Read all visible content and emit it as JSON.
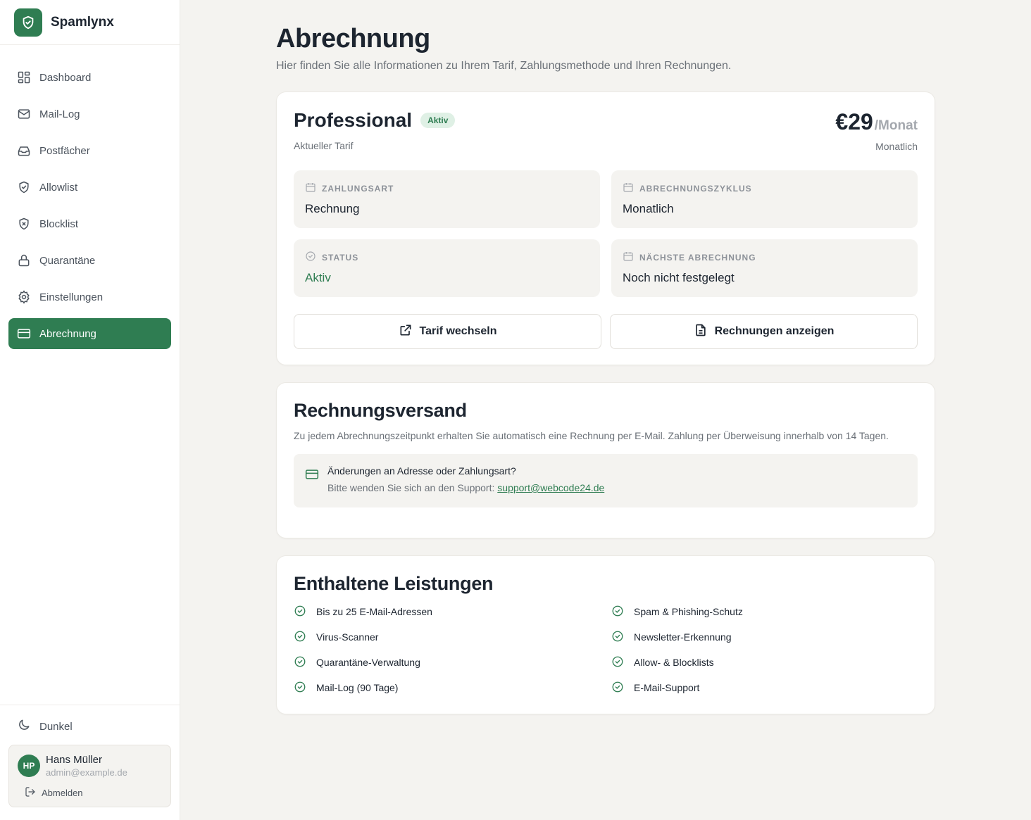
{
  "brand": {
    "name": "Spamlynx",
    "color": "#2f7d52"
  },
  "sidebar": {
    "items": [
      {
        "label": "Dashboard",
        "icon": "dashboard-icon"
      },
      {
        "label": "Mail-Log",
        "icon": "mail-icon"
      },
      {
        "label": "Postfächer",
        "icon": "inbox-icon"
      },
      {
        "label": "Allowlist",
        "icon": "shield-check-icon"
      },
      {
        "label": "Blocklist",
        "icon": "shield-x-icon"
      },
      {
        "label": "Quarantäne",
        "icon": "lock-icon"
      },
      {
        "label": "Einstellungen",
        "icon": "gear-icon"
      },
      {
        "label": "Abrechnung",
        "icon": "credit-card-icon",
        "active": true
      }
    ],
    "theme_label": "Dunkel",
    "user": {
      "initials": "HP",
      "name": "Hans Müller",
      "email": "admin@example.de"
    },
    "logout_label": "Abmelden"
  },
  "page": {
    "title": "Abrechnung",
    "subtitle": "Hier finden Sie alle Informationen zu Ihrem Tarif, Zahlungsmethode und Ihren Rechnungen."
  },
  "plan": {
    "name": "Professional",
    "badge": "Aktiv",
    "caption": "Aktueller Tarif",
    "price": "€29",
    "price_unit": "/Monat",
    "price_caption": "Monatlich",
    "tiles": {
      "payment_label": "Zahlungsart",
      "payment_value": "Rechnung",
      "cycle_label": "Abrechnungszyklus",
      "cycle_value": "Monatlich",
      "status_label": "Status",
      "status_value": "Aktiv",
      "next_label": "Nächste Abrechnung",
      "next_value": "Noch nicht festgelegt"
    },
    "change_plan_label": "Tarif wechseln",
    "show_invoices_label": "Rechnungen anzeigen"
  },
  "invoice": {
    "title": "Rechnungsversand",
    "text": "Zu jedem Abrechnungszeitpunkt erhalten Sie automatisch eine Rechnung per E-Mail. Zahlung per Überweisung innerhalb von 14 Tagen.",
    "notice_title": "Änderungen an Adresse oder Zahlungsart?",
    "notice_text": "Bitte wenden Sie sich an den Support: ",
    "notice_link": "support@webcode24.de"
  },
  "features": {
    "title": "Enthaltene Leistungen",
    "items": [
      "Bis zu 25 E-Mail-Adressen",
      "Spam & Phishing-Schutz",
      "Virus-Scanner",
      "Newsletter-Erkennung",
      "Quarantäne-Verwaltung",
      "Allow- & Blocklists",
      "Mail-Log (90 Tage)",
      "E-Mail-Support"
    ]
  }
}
